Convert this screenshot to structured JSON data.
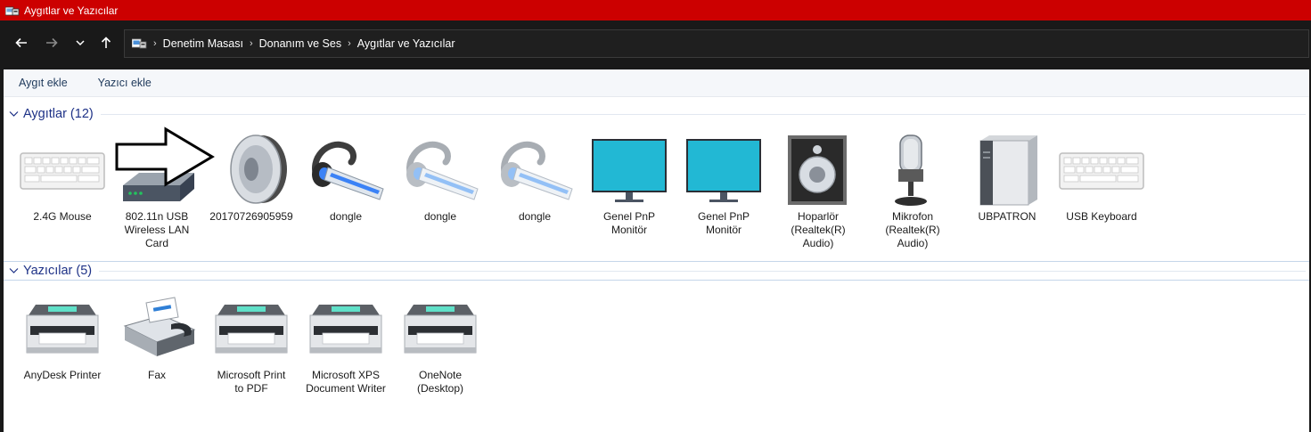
{
  "window": {
    "title": "Aygıtlar ve Yazıcılar"
  },
  "nav": {
    "back_icon": "back-arrow-icon",
    "forward_icon": "forward-arrow-icon",
    "recent_icon": "chevron-down-icon",
    "up_icon": "up-arrow-icon"
  },
  "address": {
    "crumbs": [
      "Denetim Masası",
      "Donanım ve Ses",
      "Aygıtlar ve Yazıcılar"
    ]
  },
  "toolbar": {
    "add_device": "Aygıt ekle",
    "add_printer": "Yazıcı ekle"
  },
  "groups": {
    "devices": {
      "title": "Aygıtlar (12)"
    },
    "printers": {
      "title": "Yazıcılar (5)"
    }
  },
  "devices": [
    {
      "label": "2.4G Mouse",
      "icon": "keyboard-icon"
    },
    {
      "label": "802.11n USB\nWireless LAN\nCard",
      "icon": "wifi-adapter-icon"
    },
    {
      "label": "20170726905959",
      "icon": "speaker-icon"
    },
    {
      "label": "dongle",
      "icon": "headset-icon"
    },
    {
      "label": "dongle",
      "icon": "headset-icon"
    },
    {
      "label": "dongle",
      "icon": "headset-icon"
    },
    {
      "label": "Genel PnP\nMonitör",
      "icon": "monitor-icon"
    },
    {
      "label": "Genel PnP\nMonitör",
      "icon": "monitor-icon"
    },
    {
      "label": "Hoparlör\n(Realtek(R)\nAudio)",
      "icon": "speaker-box-icon"
    },
    {
      "label": "Mikrofon\n(Realtek(R)\nAudio)",
      "icon": "microphone-icon"
    },
    {
      "label": "UBPATRON",
      "icon": "computer-tower-icon"
    },
    {
      "label": "USB Keyboard",
      "icon": "keyboard-icon"
    }
  ],
  "printers": [
    {
      "label": "AnyDesk Printer",
      "icon": "printer-icon"
    },
    {
      "label": "Fax",
      "icon": "fax-icon"
    },
    {
      "label": "Microsoft Print\nto PDF",
      "icon": "printer-icon"
    },
    {
      "label": "Microsoft XPS\nDocument Writer",
      "icon": "printer-icon"
    },
    {
      "label": "OneNote\n(Desktop)",
      "icon": "printer-icon"
    }
  ],
  "colors": {
    "titlebar": "#cc0000",
    "navbar": "#191919",
    "group_title": "#1e3287",
    "command_text": "#1e395b"
  }
}
